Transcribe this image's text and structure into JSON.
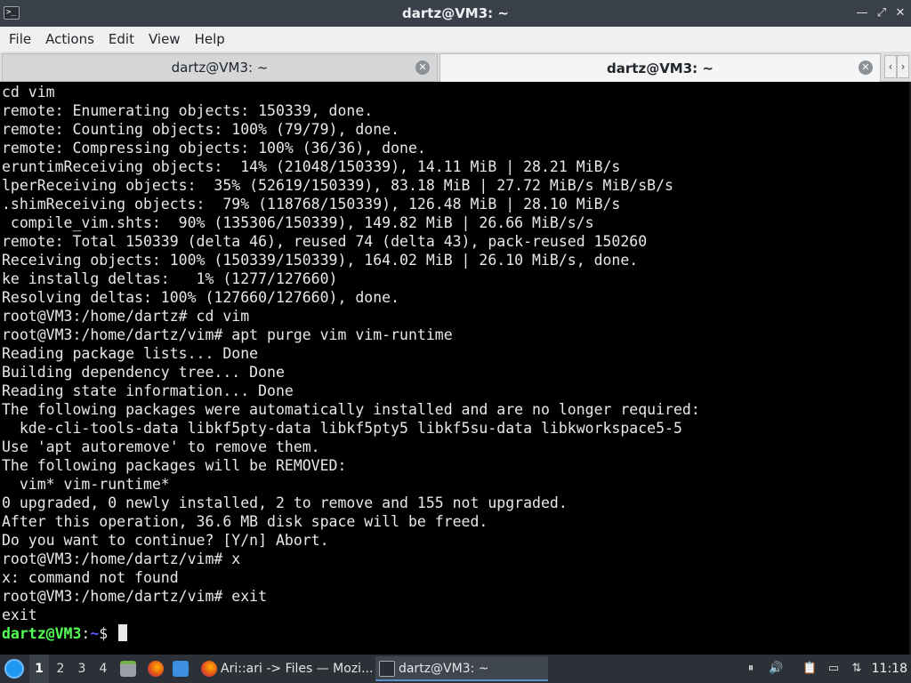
{
  "window": {
    "title": "dartz@VM3: ~",
    "app_icon_glyph": ">_",
    "controls": {
      "minimize": "—",
      "maximize": "⤢",
      "close": "✕"
    }
  },
  "menu": {
    "items": [
      "File",
      "Actions",
      "Edit",
      "View",
      "Help"
    ]
  },
  "tabs": [
    {
      "label": "dartz@VM3: ~",
      "active": false
    },
    {
      "label": "dartz@VM3: ~",
      "active": true
    }
  ],
  "tab_nav": {
    "prev": "‹",
    "next": "›"
  },
  "terminal": {
    "lines": [
      "cd vim",
      "remote: Enumerating objects: 150339, done.",
      "remote: Counting objects: 100% (79/79), done.",
      "remote: Compressing objects: 100% (36/36), done.",
      "eruntimReceiving objects:  14% (21048/150339), 14.11 MiB | 28.21 MiB/s",
      "lperReceiving objects:  35% (52619/150339), 83.18 MiB | 27.72 MiB/s MiB/sB/s",
      ".shimReceiving objects:  79% (118768/150339), 126.48 MiB | 28.10 MiB/s",
      " compile_vim.shts:  90% (135306/150339), 149.82 MiB | 26.66 MiB/s/s",
      "remote: Total 150339 (delta 46), reused 74 (delta 43), pack-reused 150260",
      "Receiving objects: 100% (150339/150339), 164.02 MiB | 26.10 MiB/s, done.",
      "ke installg deltas:   1% (1277/127660)",
      "Resolving deltas: 100% (127660/127660), done.",
      "root@VM3:/home/dartz# cd vim",
      "root@VM3:/home/dartz/vim# apt purge vim vim-runtime",
      "Reading package lists... Done",
      "Building dependency tree... Done",
      "Reading state information... Done",
      "The following packages were automatically installed and are no longer required:",
      "  kde-cli-tools-data libkf5pty-data libkf5pty5 libkf5su-data libkworkspace5-5",
      "Use 'apt autoremove' to remove them.",
      "The following packages will be REMOVED:",
      "  vim* vim-runtime*",
      "0 upgraded, 0 newly installed, 2 to remove and 155 not upgraded.",
      "After this operation, 36.6 MB disk space will be freed.",
      "Do you want to continue? [Y/n] Abort.",
      "root@VM3:/home/dartz/vim# x",
      "x: command not found",
      "root@VM3:/home/dartz/vim# exit",
      "exit"
    ],
    "prompt": {
      "user_host": "dartz@VM3",
      "colon": ":",
      "path": "~",
      "symbol": "$ "
    },
    "colors": {
      "fg": "#e8e8e8",
      "bg": "#000000",
      "user": "#54ff54",
      "path": "#5c5cff"
    }
  },
  "taskbar": {
    "workspaces": [
      "1",
      "2",
      "3",
      "4"
    ],
    "active_workspace": "1",
    "tasks": [
      {
        "label": "Ari::ari -> Files — Mozi...",
        "icon": "firefox-icon"
      },
      {
        "label": "dartz@VM3: ~",
        "icon": "terminal-icon"
      }
    ],
    "clock": "11:18"
  }
}
